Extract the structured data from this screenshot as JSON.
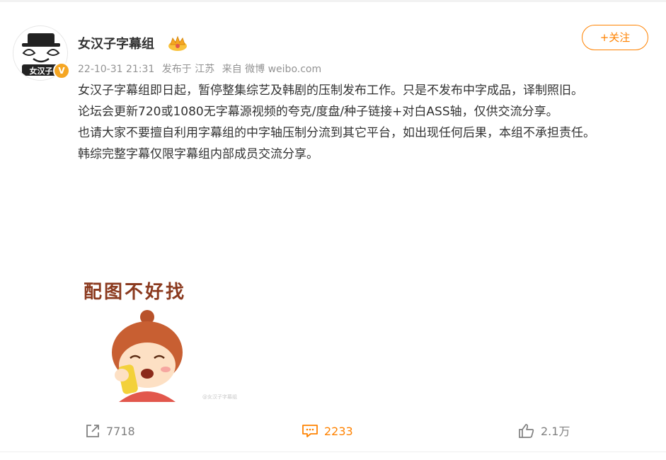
{
  "post": {
    "author": "女汉子字幕组",
    "follow_label": "+关注",
    "meta": {
      "date": "22-10-31 21:31",
      "location": "发布于 江苏",
      "source": "来自 微博 weibo.com"
    },
    "avatar_text": "女汉子",
    "verified_label": "V",
    "paragraphs": [
      "女汉子字幕组即日起，暂停整集综艺及韩剧的压制发布工作。只是不发布中字成品，译制照旧。",
      "论坛会更新720或1080无字幕源视频的夸克/度盘/种子链接+对白ASS轴，仅供交流分享。",
      "也请大家不要擅自利用字幕组的中字轴压制分流到其它平台，如出现任何后果，本组不承担责任。",
      "韩综完整字幕仅限字幕组内部成员交流分享。"
    ],
    "image_caption": "配图不好找",
    "image_watermark": "@女汉子字幕组"
  },
  "actions": {
    "share_count": "7718",
    "comment_count": "2233",
    "like_count": "2.1万"
  },
  "colors": {
    "accent": "#ff8200",
    "meta_gray": "#939393",
    "text": "#333333"
  }
}
